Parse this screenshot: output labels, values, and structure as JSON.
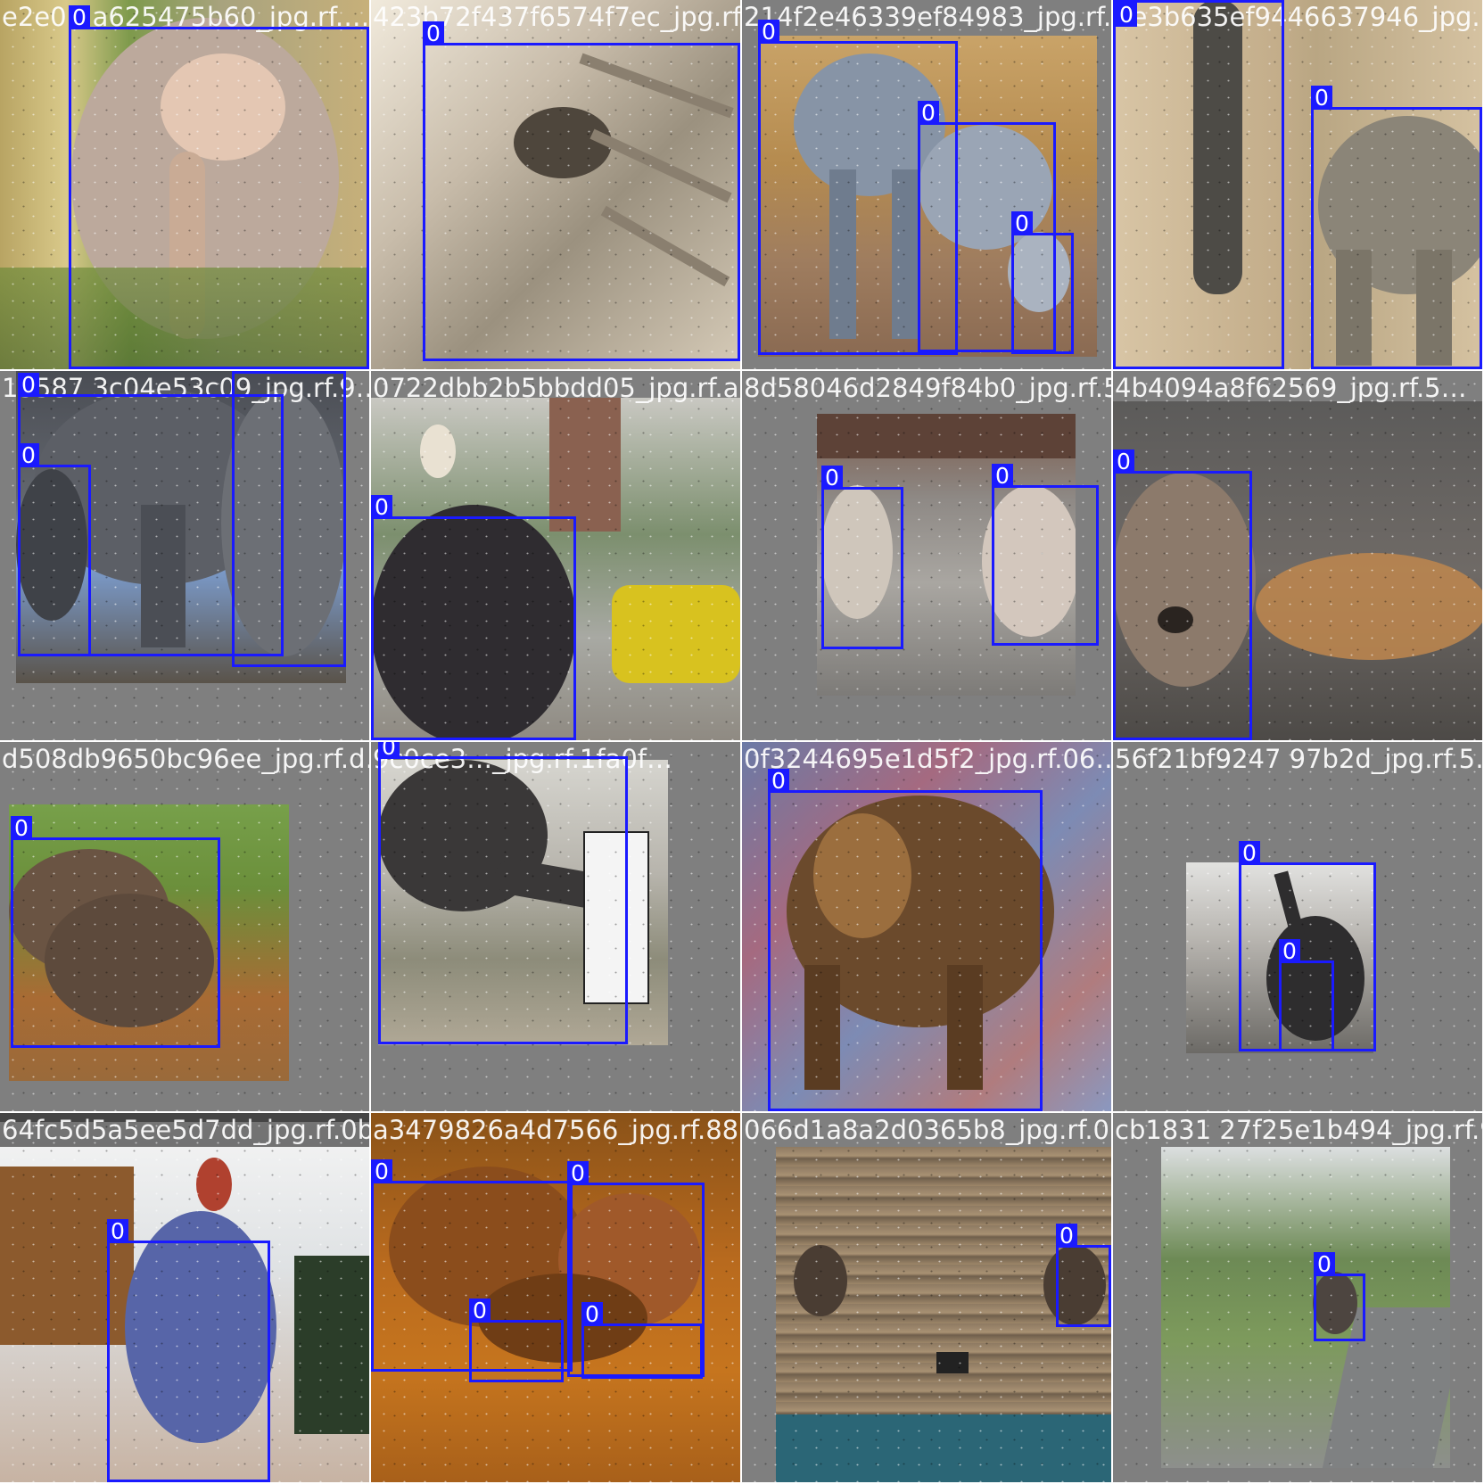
{
  "mosaic": {
    "tiles": [
      {
        "label": "e2e0…a625475b60_jpg.rf.…",
        "boxes": [
          "0"
        ]
      },
      {
        "label": "423b72f437f6574f7ec_jpg.rf.d…",
        "boxes": [
          "0"
        ]
      },
      {
        "label": "214f2e46339ef84983_jpg.rf.54…",
        "boxes": [
          "0",
          "0",
          "0"
        ]
      },
      {
        "label": "4e3b635ef9446637946_jpg.rf.b…",
        "boxes": [
          "0",
          "0"
        ]
      },
      {
        "label": "15587 3c04e53c09_jpg.rf.9…",
        "boxes": [
          "0",
          "0",
          "0"
        ]
      },
      {
        "label": "0722dbb2b5bbdd05_jpg.rf.a8…",
        "boxes": [
          "0"
        ]
      },
      {
        "label": "8d58046d2849f84b0_jpg.rf.56…",
        "boxes": [
          "0",
          "0"
        ]
      },
      {
        "label": "4b4094a8f62569_jpg.rf.5…",
        "boxes": [
          "0"
        ]
      },
      {
        "label": "d508db9650bc96ee_jpg.rf.d…",
        "boxes": [
          "0"
        ]
      },
      {
        "label": "9c0ce3…_jpg.rf.1fa0f…",
        "boxes": [
          "0"
        ]
      },
      {
        "label": "0f3244695e1d5f2_jpg.rf.06…",
        "boxes": [
          "0"
        ]
      },
      {
        "label": "56f21bf9247 97b2d_jpg.rf.5…",
        "boxes": [
          "0",
          "0"
        ]
      },
      {
        "label": "64fc5d5a5ee5d7dd_jpg.rf.0b…",
        "boxes": [
          "0"
        ]
      },
      {
        "label": "a3479826a4d7566_jpg.rf.88…",
        "boxes": [
          "0",
          "0",
          "0",
          "0"
        ]
      },
      {
        "label": "066d1a8a2d0365b8_jpg.rf.0…",
        "boxes": [
          "0"
        ]
      },
      {
        "label": "cb1831 27f25e1b494_jpg.rf.9…",
        "boxes": [
          "0"
        ]
      }
    ]
  }
}
